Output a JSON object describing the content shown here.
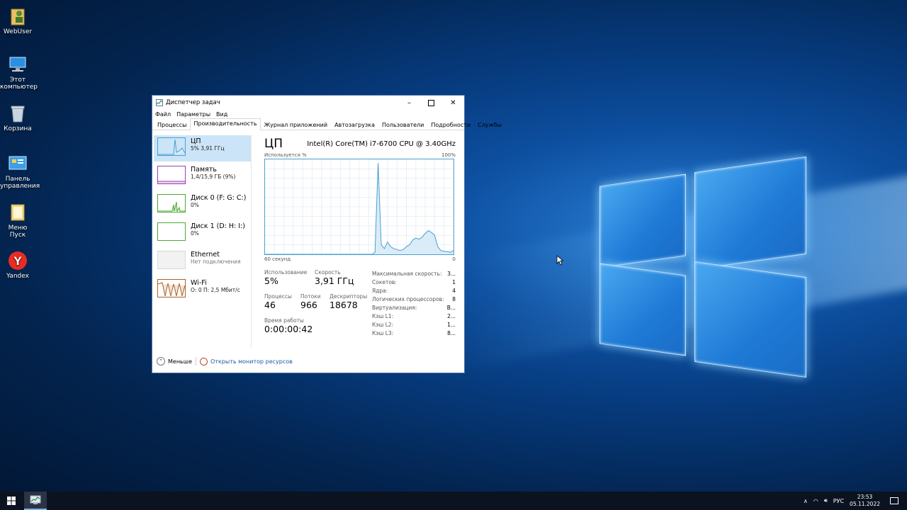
{
  "desktop": {
    "icons": [
      {
        "label": "WebUser",
        "icon": "user-folder-icon"
      },
      {
        "label": "Этот компьютер",
        "icon": "computer-icon"
      },
      {
        "label": "Корзина",
        "icon": "recycle-bin-icon"
      },
      {
        "label": "Панель управления",
        "icon": "control-panel-icon"
      },
      {
        "label": "Меню Пуск",
        "icon": "folder-icon"
      },
      {
        "label": "Yandex",
        "icon": "yandex-browser-icon"
      }
    ]
  },
  "window": {
    "title": "Диспетчер задач",
    "menu": [
      "Файл",
      "Параметры",
      "Вид"
    ],
    "tabs": [
      "Процессы",
      "Производительность",
      "Журнал приложений",
      "Автозагрузка",
      "Пользователи",
      "Подробности",
      "Службы"
    ],
    "active_tab": 1,
    "sidebar": [
      {
        "name": "ЦП",
        "sub": "5% 3,91 ГГц",
        "color": "#4b9fcf"
      },
      {
        "name": "Память",
        "sub": "1,4/15,9 ГБ (9%)",
        "color": "#9b3fb0"
      },
      {
        "name": "Диск 0 (F: G: C:)",
        "sub": "0%",
        "color": "#4aa832"
      },
      {
        "name": "Диск 1 (D: H: I:)",
        "sub": "0%",
        "color": "#4aa832"
      },
      {
        "name": "Ethernet",
        "sub": "Нет подключения",
        "color": "#d0d0d0"
      },
      {
        "name": "Wi-Fi",
        "sub": "О: 0 П: 2,5 Мбит/с",
        "color": "#a8642a"
      }
    ],
    "main": {
      "title": "ЦП",
      "model": "Intel(R) Core(TM) i7-6700 CPU @ 3.40GHz",
      "graph_top_left": "Используется %",
      "graph_top_right": "100%",
      "graph_bottom_left": "60 секунд",
      "graph_bottom_right": "0",
      "usage_label": "Использование",
      "usage_value": "5%",
      "speed_label": "Скорость",
      "speed_value": "3,91 ГГц",
      "proc_label": "Процессы",
      "proc_value": "46",
      "threads_label": "Потоки",
      "threads_value": "966",
      "handles_label": "Дескрипторы",
      "handles_value": "18678",
      "uptime_label": "Время работы",
      "uptime_value": "0:00:00:42",
      "kv": [
        {
          "k": "Максимальная скорость:",
          "v": "3..."
        },
        {
          "k": "Сокетов:",
          "v": "1"
        },
        {
          "k": "Ядра:",
          "v": "4"
        },
        {
          "k": "Логических процессоров:",
          "v": "8"
        },
        {
          "k": "Виртуализация:",
          "v": "В..."
        },
        {
          "k": "Кэш L1:",
          "v": "2..."
        },
        {
          "k": "Кэш L2:",
          "v": "1..."
        },
        {
          "k": "Кэш L3:",
          "v": "8..."
        }
      ]
    },
    "footer": {
      "less": "Меньше",
      "monitor": "Открыть монитор ресурсов"
    }
  },
  "chart_data": {
    "type": "area",
    "xlabel": "60 секунд",
    "ylabel": "Используется %",
    "ylim": [
      0,
      100
    ],
    "x": [
      0,
      1,
      2,
      3,
      4,
      5,
      6,
      7,
      8,
      9,
      10,
      11,
      12,
      13,
      14,
      15,
      16,
      17,
      18,
      19,
      20,
      21,
      22,
      23,
      24,
      25,
      26,
      27,
      28,
      29,
      30,
      31,
      32,
      33,
      34,
      35,
      36,
      37,
      38,
      39,
      40,
      41,
      42,
      43,
      44,
      45,
      46,
      47,
      48,
      49,
      50,
      51,
      52,
      53,
      54,
      55,
      56,
      57,
      58,
      59,
      60
    ],
    "values": [
      0,
      0,
      0,
      0,
      0,
      0,
      0,
      0,
      0,
      0,
      0,
      0,
      0,
      0,
      0,
      0,
      0,
      0,
      0,
      0,
      0,
      0,
      0,
      0,
      0,
      0,
      0,
      0,
      0,
      0,
      0,
      0,
      0,
      0,
      0,
      2,
      96,
      10,
      6,
      13,
      8,
      6,
      5,
      4,
      5,
      8,
      10,
      15,
      17,
      16,
      18,
      22,
      25,
      23,
      20,
      8,
      4,
      3,
      3,
      2,
      4
    ],
    "color": "#4b9fcf"
  },
  "taskbar": {
    "lang": "РУС",
    "time": "23:53",
    "date": "05.11.2022"
  }
}
